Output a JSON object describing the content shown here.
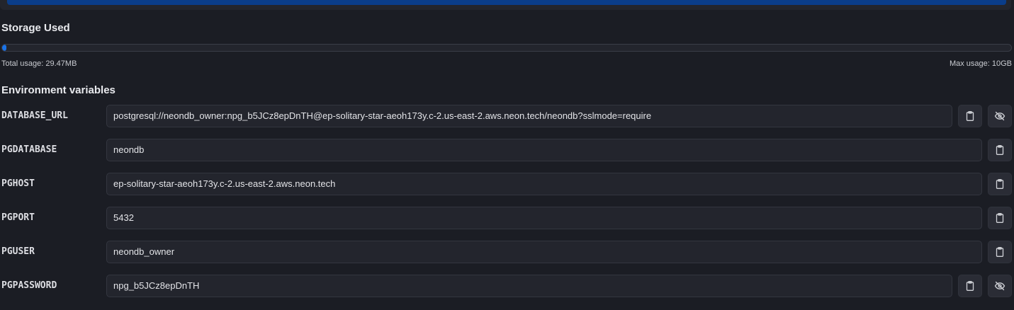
{
  "storage": {
    "title": "Storage Used",
    "total_usage": "Total usage: 29.47MB",
    "max_usage": "Max usage: 10GB",
    "used_fraction": 0.0029
  },
  "env": {
    "title": "Environment variables",
    "vars": [
      {
        "key": "DATABASE_URL",
        "value": "postgresql://neondb_owner:npg_b5JCz8epDnTH@ep-solitary-star-aeoh173y.c-2.us-east-2.aws.neon.tech/neondb?sslmode=require",
        "secret": true
      },
      {
        "key": "PGDATABASE",
        "value": "neondb",
        "secret": false
      },
      {
        "key": "PGHOST",
        "value": "ep-solitary-star-aeoh173y.c-2.us-east-2.aws.neon.tech",
        "secret": false
      },
      {
        "key": "PGPORT",
        "value": "5432",
        "secret": false
      },
      {
        "key": "PGUSER",
        "value": "neondb_owner",
        "secret": false
      },
      {
        "key": "PGPASSWORD",
        "value": "npg_b5JCz8epDnTH",
        "secret": true
      }
    ]
  },
  "icons": {
    "copy": "clipboard-icon",
    "reveal": "eye-off-icon"
  },
  "colors": {
    "background": "#1b1d24",
    "accent": "#1a73e8",
    "field": "#23252d"
  }
}
